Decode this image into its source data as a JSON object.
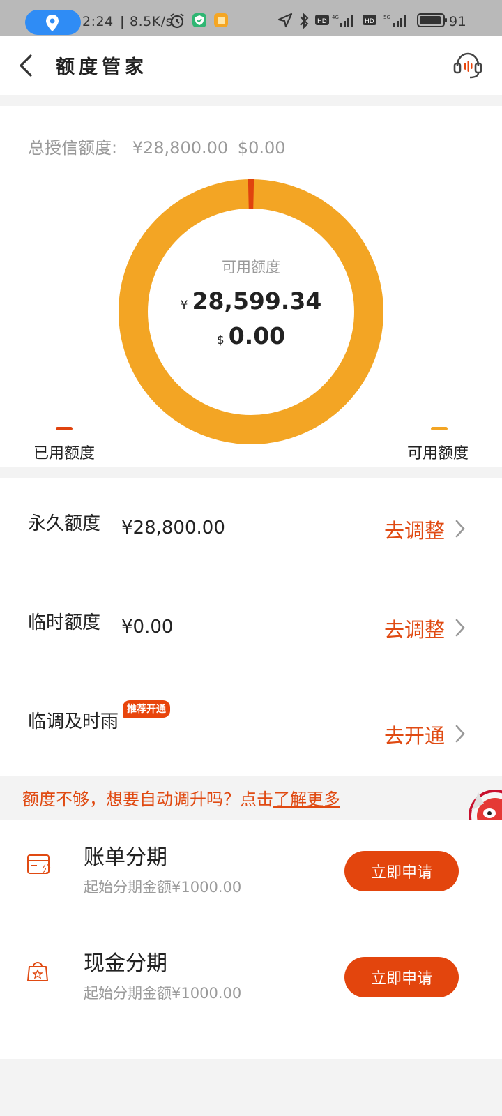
{
  "status_bar": {
    "time": "2:24",
    "net_speed": "8.5K/s",
    "battery_pct": "91"
  },
  "header": {
    "title": "额度管家"
  },
  "credit": {
    "total_label": "总授信额度:",
    "total_cny": "¥28,800.00",
    "total_usd": "$0.00",
    "available_label": "可用额度",
    "cny_symbol": "¥",
    "available_cny": "28,599.34",
    "usd_symbol": "$",
    "available_usd": "0.00",
    "legend_used": "已用额度",
    "legend_available": "可用额度",
    "used_fraction": 0.007,
    "colors": {
      "used": "#e0430e",
      "available": "#f3a524"
    }
  },
  "limits": [
    {
      "label": "永久额度",
      "value": "¥28,800.00",
      "action": "去调整"
    },
    {
      "label": "临时额度",
      "value": "¥0.00",
      "action": "去调整"
    },
    {
      "label": "临调及时雨",
      "value": "",
      "badge": "推荐开通",
      "action": "去开通"
    }
  ],
  "promo": {
    "text": "额度不够，想要自动调升吗？点击",
    "link": "了解更多"
  },
  "installments": [
    {
      "title": "账单分期",
      "subtitle": "起始分期金额¥1000.00",
      "button": "立即申请",
      "icon": "bill-card-icon",
      "icon_text": "分"
    },
    {
      "title": "现金分期",
      "subtitle": "起始分期金额¥1000.00",
      "button": "立即申请",
      "icon": "cash-bag-icon"
    }
  ],
  "accent_color": "#e04a12"
}
